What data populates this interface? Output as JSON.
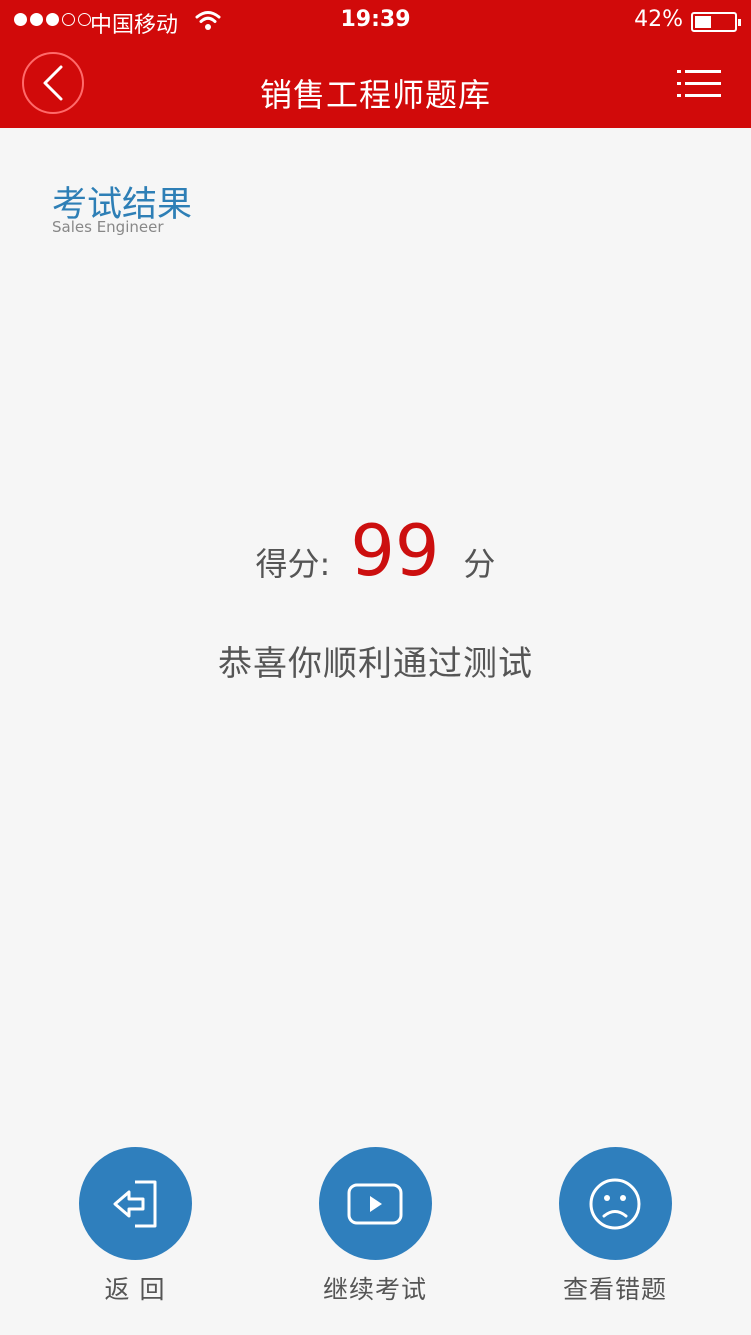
{
  "status_bar": {
    "carrier": "中国移动",
    "time": "19:39",
    "battery": "42%",
    "battery_level": 0.42,
    "signal_strength": 3
  },
  "nav": {
    "title": "销售工程师题库",
    "back_icon": "chevron-left-icon",
    "menu_icon": "list-menu-icon"
  },
  "section": {
    "title": "考试结果",
    "subtitle": "Sales Engineer"
  },
  "result": {
    "score_label": "得分:",
    "score": "99",
    "score_unit": "分",
    "message": "恭喜你顺利通过测试"
  },
  "actions": [
    {
      "label": "返 回",
      "icon": "exit-arrow-icon"
    },
    {
      "label": "继续考试",
      "icon": "play-icon"
    },
    {
      "label": "查看错题",
      "icon": "sad-face-icon"
    }
  ],
  "colors": {
    "header": "#d10a0a",
    "accent_blue": "#2f7fbd",
    "score_red": "#cc0f0f",
    "background": "#f6f6f6"
  }
}
